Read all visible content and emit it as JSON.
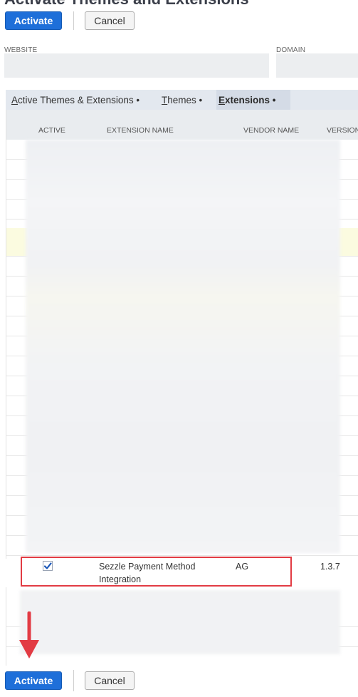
{
  "page": {
    "title": "Activate Themes and Extensions"
  },
  "toolbar_top": {
    "activate_label": "Activate",
    "cancel_label": "Cancel"
  },
  "fields": {
    "website_label": "WEBSITE",
    "domain_label": "DOMAIN",
    "website_value": "",
    "domain_value": ""
  },
  "tabs": [
    {
      "first": "A",
      "rest": "ctive Themes & Extensions •"
    },
    {
      "first": "T",
      "rest": "hemes •"
    },
    {
      "first": "E",
      "rest": "xtensions •"
    }
  ],
  "grid": {
    "headers": [
      "ACTIVE",
      "EXTENSION NAME",
      "VENDOR NAME",
      "VERSION"
    ],
    "selected_row": {
      "checked": true,
      "name_line1": "Sezzle Payment Method",
      "name_line2": "Integration",
      "vendor": "AG",
      "version": "1.3.7"
    }
  },
  "toolbar_bottom": {
    "activate_label": "Activate",
    "cancel_label": "Cancel"
  },
  "colors": {
    "primary": "#1e6fd9",
    "highlight": "#e23b43",
    "row_highlight": "#fbfbe0"
  },
  "icons": {
    "checkbox": "check-icon",
    "arrow": "arrow-down-icon"
  }
}
